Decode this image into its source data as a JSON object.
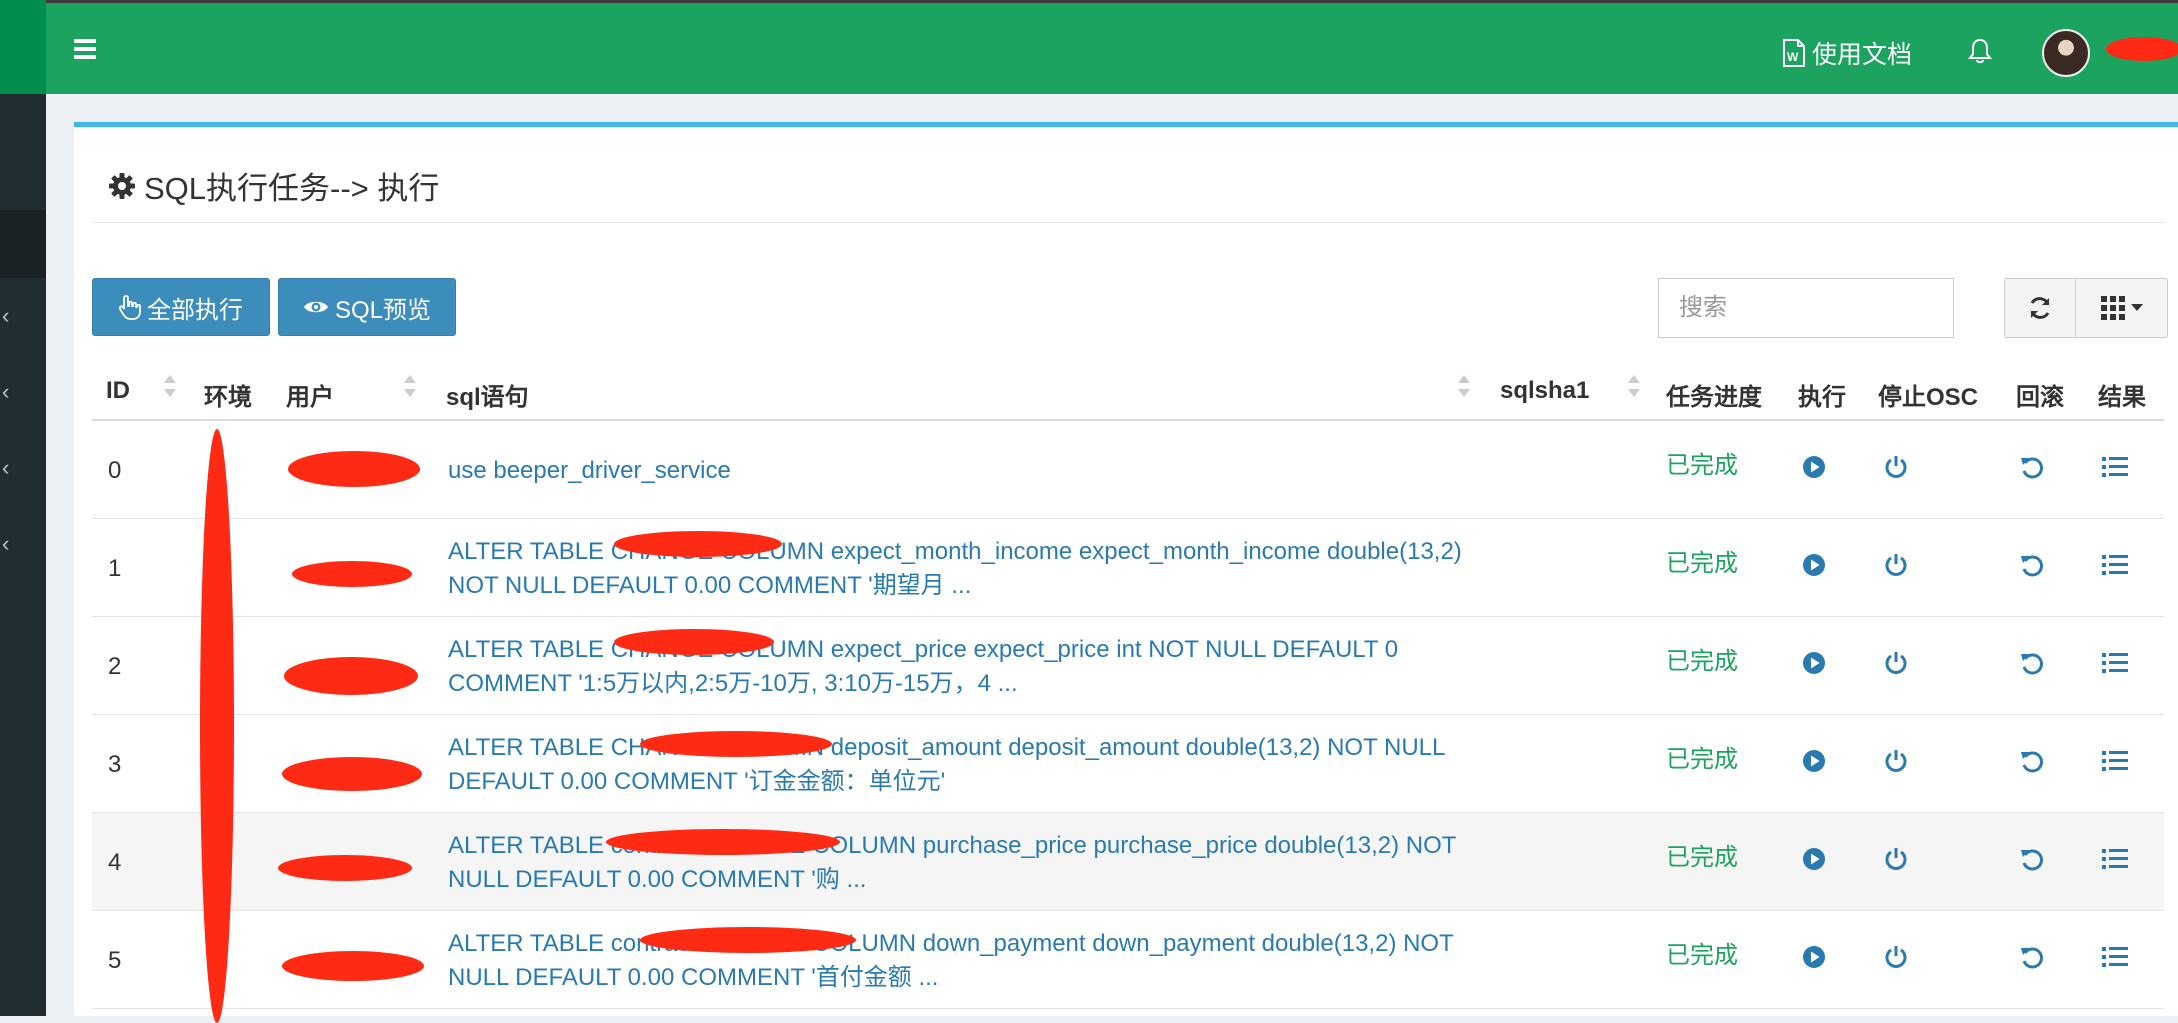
{
  "header": {
    "docs_label": "使用文档",
    "docs_icon": "word-file-icon",
    "bell_icon": "bell-icon",
    "menu_icon": "hamburger-icon"
  },
  "page": {
    "title": "SQL执行任务--> 执行",
    "title_icon": "gear-icon"
  },
  "toolbar": {
    "execute_all_label": "全部执行",
    "execute_all_icon": "hand-pointer-icon",
    "preview_label": "SQL预览",
    "preview_icon": "eye-icon",
    "search_placeholder": "搜索",
    "refresh_icon": "refresh-icon",
    "columns_icon": "grid-icon"
  },
  "table": {
    "columns": [
      "ID",
      "环境",
      "用户",
      "sql语句",
      "sqlsha1",
      "任务进度",
      "执行",
      "停止OSC",
      "回滚",
      "结果"
    ],
    "rows": [
      {
        "id": "0",
        "env": "",
        "user": "",
        "sql": "use beeper_driver_service",
        "sqlsha1": "",
        "progress": "已完成"
      },
      {
        "id": "1",
        "env": "",
        "user": "",
        "sql": "ALTER TABLE CHANGE COLUMN expect_month_income expect_month_income double(13,2) NOT NULL DEFAULT 0.00 COMMENT '期望月 ...",
        "sqlsha1": "",
        "progress": "已完成"
      },
      {
        "id": "2",
        "env": "",
        "user": "",
        "sql": "ALTER TABLE CHANGE COLUMN expect_price expect_price int NOT NULL DEFAULT 0 COMMENT '1:5万以内,2:5万-10万, 3:10万-15万，4 ...",
        "sqlsha1": "",
        "progress": "已完成"
      },
      {
        "id": "3",
        "env": "",
        "user": "",
        "sql": "ALTER TABLE CHANGE COLUMN deposit_amount deposit_amount double(13,2) NOT NULL DEFAULT 0.00 COMMENT '订金金额：单位元'",
        "sqlsha1": "",
        "progress": "已完成"
      },
      {
        "id": "4",
        "env": "",
        "user": "",
        "sql": "ALTER TABLE contract CHANGE COLUMN purchase_price purchase_price double(13,2) NOT NULL DEFAULT 0.00 COMMENT '购 ...",
        "sqlsha1": "",
        "progress": "已完成"
      },
      {
        "id": "5",
        "env": "",
        "user": "",
        "sql": "ALTER TABLE contract CHANGE COLUMN down_payment down_payment double(13,2) NOT NULL DEFAULT 0.00 COMMENT '首付金额 ...",
        "sqlsha1": "",
        "progress": "已完成"
      }
    ],
    "action_icons": [
      "play-circle-icon",
      "power-icon",
      "undo-icon",
      "list-icon"
    ]
  },
  "colors": {
    "header": "#1ba35f",
    "sidebar": "#222d32",
    "primary": "#3c8dbc",
    "success_text": "#1ba35f",
    "link": "#2a7ab0",
    "box_accent": "#3cb8e5",
    "redaction": "#ff2a14"
  }
}
